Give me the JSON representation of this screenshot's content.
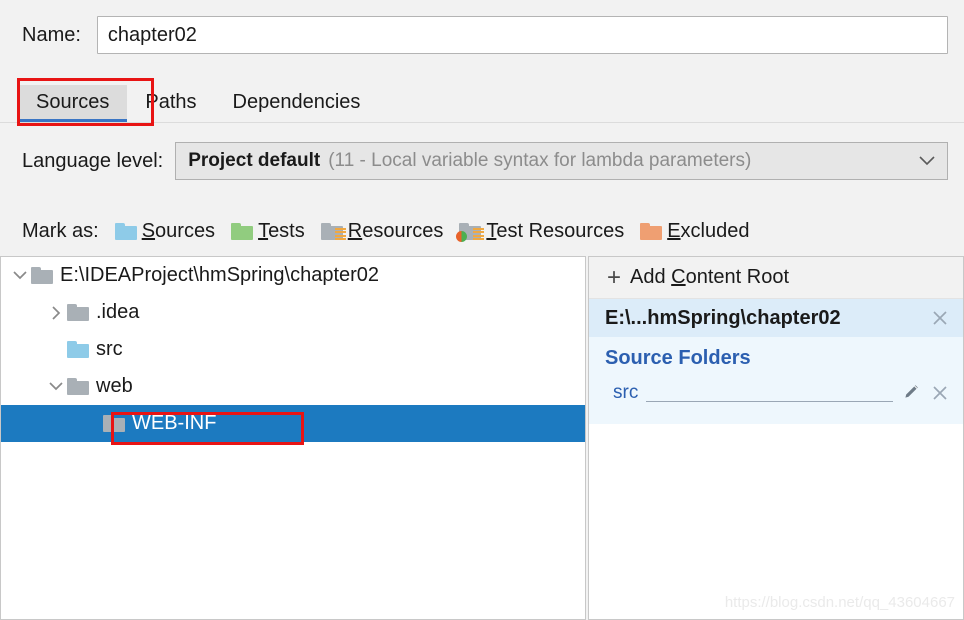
{
  "name_row": {
    "label": "Name:",
    "value": "chapter02"
  },
  "tabs": [
    {
      "label": "Sources",
      "active": true
    },
    {
      "label": "Paths",
      "active": false
    },
    {
      "label": "Dependencies",
      "active": false
    }
  ],
  "language_level": {
    "label": "Language level:",
    "value": "Project default",
    "hint": "(11 - Local variable syntax for lambda parameters)",
    "arrow_icon": "chevron-down-icon"
  },
  "mark_as": {
    "label": "Mark as:",
    "items": [
      {
        "mnemonic": "S",
        "rest": "ources",
        "icon": "folder-sources-icon",
        "color": "#8ecbe8"
      },
      {
        "mnemonic": "T",
        "rest": "ests",
        "icon": "folder-tests-icon",
        "color": "#91cc7f"
      },
      {
        "mnemonic": "R",
        "rest": "esources",
        "icon": "folder-resources-icon",
        "color": "#a9b0b6"
      },
      {
        "mnemonic": "T",
        "rest": "est Resources",
        "icon": "folder-test-resources-icon",
        "color": "#a9b0b6"
      },
      {
        "mnemonic": "E",
        "rest": "xcluded",
        "icon": "folder-excluded-icon",
        "color": "#ef9f72"
      }
    ]
  },
  "tree": {
    "rows": [
      {
        "label": "E:\\IDEAProject\\hmSpring\\chapter02",
        "indent": 0,
        "chevron": "expanded",
        "folder": "gray",
        "selected": false
      },
      {
        "label": ".idea",
        "indent": 1,
        "chevron": "collapsed",
        "folder": "gray",
        "selected": false
      },
      {
        "label": "src",
        "indent": 2,
        "chevron": "none",
        "folder": "blue",
        "selected": false
      },
      {
        "label": "web",
        "indent": 1,
        "chevron": "expanded",
        "folder": "gray",
        "selected": false
      },
      {
        "label": "WEB-INF",
        "indent": 2,
        "chevron": "none",
        "folder": "gray",
        "selected": true
      }
    ]
  },
  "right_panel": {
    "add_content_root": {
      "mnemonic_pre": "Add ",
      "mnemonic": "C",
      "mnemonic_post": "ontent Root",
      "icon": "plus-icon"
    },
    "content_root": {
      "path": "E:\\...hmSpring\\chapter02",
      "remove_icon": "close-icon"
    },
    "source_folders_title": "Source Folders",
    "source_folders": [
      {
        "name": "src",
        "edit_icon": "pencil-icon",
        "remove_icon": "close-icon"
      }
    ]
  },
  "watermark": "https://blog.csdn.net/qq_43604667",
  "colors": {
    "selection_blue": "#1c7ac0",
    "annotation_red": "#e81414",
    "accent_blue": "#2b5fb0",
    "tab_underline": "#3a75c4"
  }
}
